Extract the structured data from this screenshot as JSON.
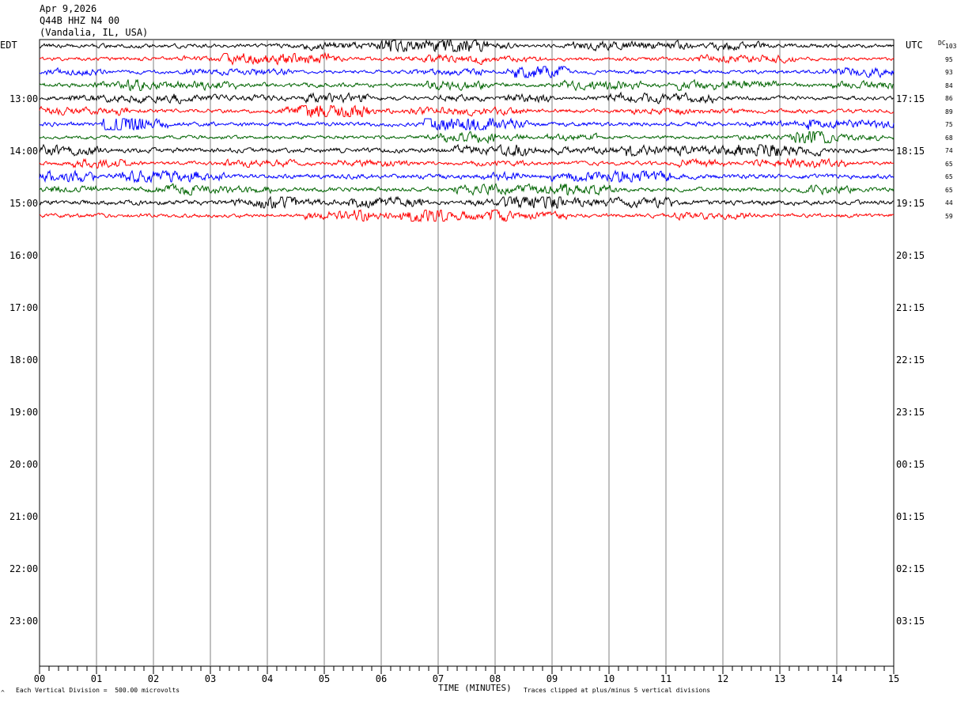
{
  "header": {
    "date": "Apr 9,2026",
    "station": "Q44B HHZ N4 00",
    "location": "(Vandalia, IL, USA)"
  },
  "left_axis_title": "EDT",
  "right_axis_title": "UTC",
  "dc_title": "DC",
  "footer": {
    "scale_note": "Each Vertical Division =  500.00 microvolts",
    "xlabel": "TIME (MINUTES)",
    "clip_note": "Traces clipped at plus/minus 5 vertical divisions",
    "corner_mark": "^"
  },
  "chart_data": {
    "type": "line",
    "title": "",
    "xlabel": "TIME (MINUTES)",
    "ylabel": "",
    "xlim": [
      0,
      15
    ],
    "x_ticks": [
      "00",
      "01",
      "02",
      "03",
      "04",
      "05",
      "06",
      "07",
      "08",
      "09",
      "10",
      "11",
      "12",
      "13",
      "14",
      "15"
    ],
    "grid": true,
    "trace_colors": [
      "#000000",
      "#ff0000",
      "#0000ff",
      "#006400"
    ],
    "left_hour_labels": [
      "13:00",
      "14:00",
      "15:00",
      "16:00",
      "17:00",
      "18:00",
      "19:00",
      "20:00",
      "21:00",
      "22:00",
      "23:00"
    ],
    "right_hour_labels": [
      "17:15",
      "18:15",
      "19:15",
      "20:15",
      "21:15",
      "22:15",
      "23:15",
      "00:15",
      "01:15",
      "02:15",
      "03:15"
    ],
    "traces": [
      {
        "row": 0,
        "color": "#000000",
        "dc": "103",
        "amplitude": 2.2
      },
      {
        "row": 1,
        "color": "#ff0000",
        "dc": "95",
        "amplitude": 2.0
      },
      {
        "row": 2,
        "color": "#0000ff",
        "dc": "93",
        "amplitude": 2.0
      },
      {
        "row": 3,
        "color": "#006400",
        "dc": "84",
        "amplitude": 2.4
      },
      {
        "row": 4,
        "color": "#000000",
        "dc": "86",
        "amplitude": 2.2
      },
      {
        "row": 5,
        "color": "#ff0000",
        "dc": "89",
        "amplitude": 2.2
      },
      {
        "row": 6,
        "color": "#0000ff",
        "dc": "75",
        "amplitude": 2.3
      },
      {
        "row": 7,
        "color": "#006400",
        "dc": "68",
        "amplitude": 2.0
      },
      {
        "row": 8,
        "color": "#000000",
        "dc": "74",
        "amplitude": 2.6
      },
      {
        "row": 9,
        "color": "#ff0000",
        "dc": "65",
        "amplitude": 2.2
      },
      {
        "row": 10,
        "color": "#0000ff",
        "dc": "65",
        "amplitude": 2.6
      },
      {
        "row": 11,
        "color": "#006400",
        "dc": "65",
        "amplitude": 2.4
      },
      {
        "row": 12,
        "color": "#000000",
        "dc": "44",
        "amplitude": 2.6
      },
      {
        "row": 13,
        "color": "#ff0000",
        "dc": "59",
        "amplitude": 2.2
      }
    ]
  }
}
